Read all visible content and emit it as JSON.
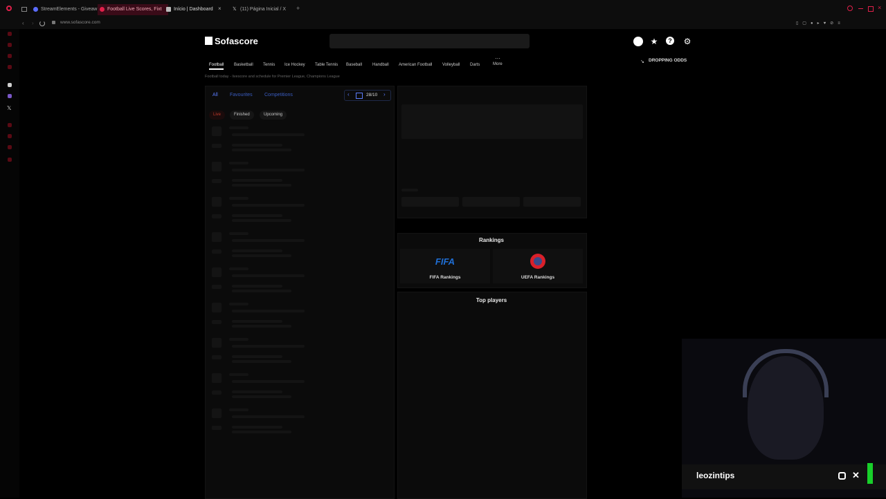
{
  "browser": {
    "tabs": [
      {
        "title": "StreamElements - Giveaw",
        "color": "#5b6cff"
      },
      {
        "title": "Football Live Scores, Fixt",
        "color": "#e0204a"
      },
      {
        "title": "Início | Dashboard",
        "color": "#cccccc"
      },
      {
        "title": "(11) Página Inicial / X",
        "color": "#cccccc"
      }
    ],
    "url": "www.sofascore.com"
  },
  "site": {
    "logo": "Sofascore",
    "nav": [
      "Football",
      "Basketball",
      "Tennis",
      "Ice Hockey",
      "Table Tennis",
      "Baseball",
      "Handball",
      "American Football",
      "Volleyball",
      "Darts",
      "More"
    ],
    "dropping_odds": "DROPPING ODDS",
    "breadcrumb": "Football today - livescore and schedule for Premier League, Champions League",
    "filters": {
      "all": "All",
      "favourites": "Favourites",
      "competitions": "Competitions",
      "date": "28/10"
    },
    "status_pills": [
      "Live",
      "Finished",
      "Upcoming"
    ],
    "rankings": {
      "title": "Rankings",
      "fifa_logo": "FIFA",
      "fifa": "FIFA Rankings",
      "uefa": "UEFA Rankings"
    },
    "top_players": "Top players"
  },
  "stream": {
    "name": "leozintips"
  }
}
